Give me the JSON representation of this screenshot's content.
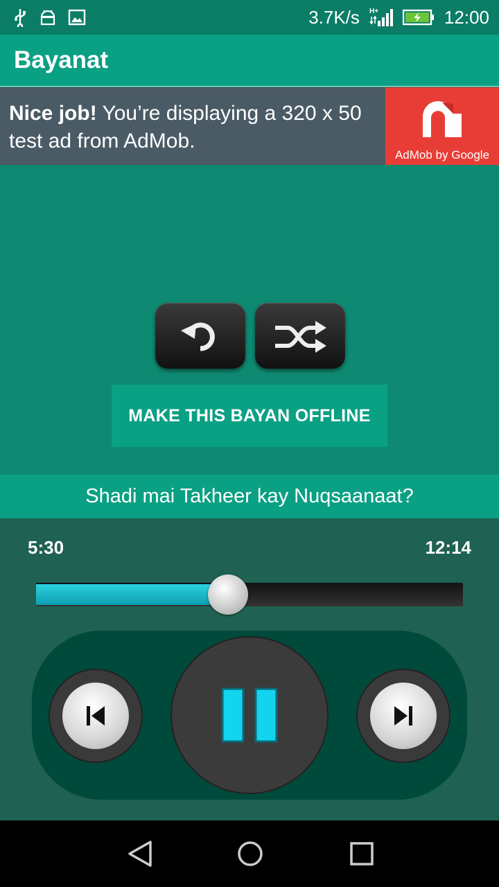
{
  "status_bar": {
    "net_speed": "3.7K/s",
    "network_type": "H+",
    "time": "12:00",
    "icons": [
      "usb-icon",
      "android-debug-icon",
      "image-icon",
      "signal-icon",
      "battery-charging-icon"
    ]
  },
  "app_bar": {
    "title": "Bayanat"
  },
  "ad": {
    "bold_text": "Nice job!",
    "text": " You’re displaying a 320 x 50 test ad from AdMob.",
    "brand": "AdMob by Google"
  },
  "controls": {
    "repeat_icon": "repeat-icon",
    "shuffle_icon": "shuffle-icon",
    "offline_button": "MAKE THIS BAYAN OFFLINE"
  },
  "track": {
    "title": "Shadi mai Takheer kay Nuqsaanaat?"
  },
  "player": {
    "current_time": "5:30",
    "total_time": "12:14",
    "progress_fraction": 0.45,
    "prev_icon": "skip-previous-icon",
    "pause_icon": "pause-icon",
    "next_icon": "skip-next-icon"
  },
  "nav_bar": {
    "icons": [
      "back-icon",
      "home-icon",
      "recents-icon"
    ]
  },
  "colors": {
    "primary": "#0aa084",
    "background": "#0f8a72",
    "player_bg": "#1f6152",
    "accent_cyan": "#1fc8dc"
  }
}
